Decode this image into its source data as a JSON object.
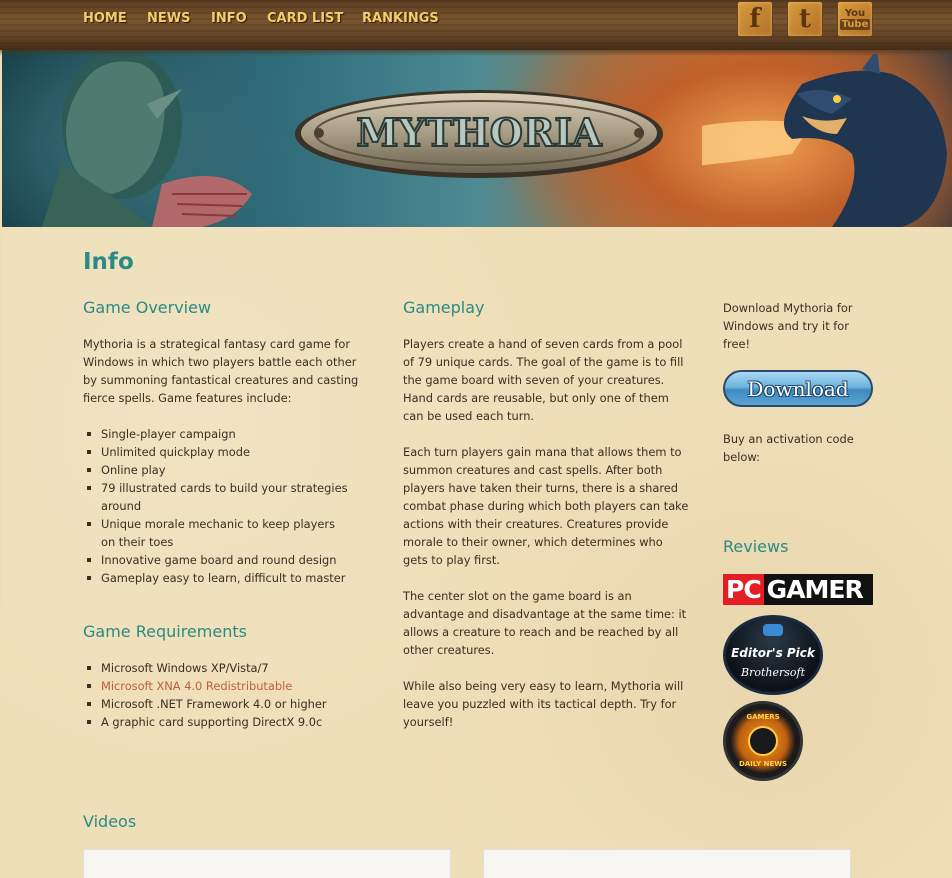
{
  "nav": {
    "items": [
      "HOME",
      "NEWS",
      "INFO",
      "CARD LIST",
      "RANKINGS"
    ]
  },
  "social": {
    "facebook_glyph": "f",
    "twitter_glyph": "t",
    "youtube_top": "You",
    "youtube_bottom": "Tube",
    "icons": [
      "facebook-icon",
      "twitter-icon",
      "youtube-icon"
    ]
  },
  "banner": {
    "logo_text": "MYTHORIA"
  },
  "page": {
    "title": "Info"
  },
  "overview": {
    "heading": "Game Overview",
    "intro": [
      "Mythoria is a strategical fantasy card game for",
      "Windows in which two players battle each other",
      "by summoning fantastical creatures and casting",
      "fierce spells. Game features include:"
    ],
    "features": [
      [
        "Single-player campaign"
      ],
      [
        "Unlimited quickplay mode"
      ],
      [
        "Online play"
      ],
      [
        "79 illustrated cards to build your strategies",
        "around"
      ],
      [
        "Unique morale mechanic to keep players",
        "on their toes"
      ],
      [
        "Innovative game board and round design"
      ],
      [
        "Gameplay easy to learn, difficult to master"
      ]
    ]
  },
  "requirements": {
    "heading": "Game Requirements",
    "items": [
      "Microsoft Windows XP/Vista/7",
      "Microsoft XNA 4.0 Redistributable",
      "Microsoft .NET Framework 4.0 or higher",
      "A graphic card supporting DirectX 9.0c"
    ]
  },
  "gameplay": {
    "heading": "Gameplay",
    "paragraphs": [
      [
        "Players create a hand of seven cards from a pool",
        "of 79 unique cards. The goal of the game is to fill",
        "the game board with seven of your creatures.",
        "Hand cards are reusable, but only one of them",
        "can be used each turn."
      ],
      [
        "Each turn players gain mana that allows them to",
        "summon creatures and cast spells. After both",
        "players have taken their turns, there is a shared",
        "combat phase during which both players can take",
        "actions with their creatures. Creatures provide",
        "morale to their owner, which determines who",
        "gets to play first."
      ],
      [
        "The center slot on the game board is an",
        "advantage and disadvantage at the same time: it",
        "allows a creature to reach and be reached by all",
        "other creatures."
      ],
      [
        "While also being very easy to learn, Mythoria will",
        "leave you puzzled with its tactical depth. Try for",
        "yourself!"
      ]
    ]
  },
  "sidebar": {
    "download_text": [
      "Download Mythoria for",
      "Windows and try it for",
      "free!"
    ],
    "download_button": "Download",
    "activation_text": [
      "Buy an activation code",
      "below:"
    ],
    "reviews_heading": "Reviews",
    "pcgamer_pc": "PC",
    "pcgamer_gamer": "GAMER",
    "editor_pick": "Editor's Pick",
    "editor_site": "Brothersoft",
    "gamers_top": "GAMERS",
    "gamers_bottom": "DAILY NEWS"
  },
  "videos": {
    "heading": "Videos"
  },
  "colors": {
    "accent_teal": "#2a8a84",
    "nav_gold": "#f5cd6a",
    "link_orange": "#c0603a",
    "parchment": "#efdfb9"
  }
}
